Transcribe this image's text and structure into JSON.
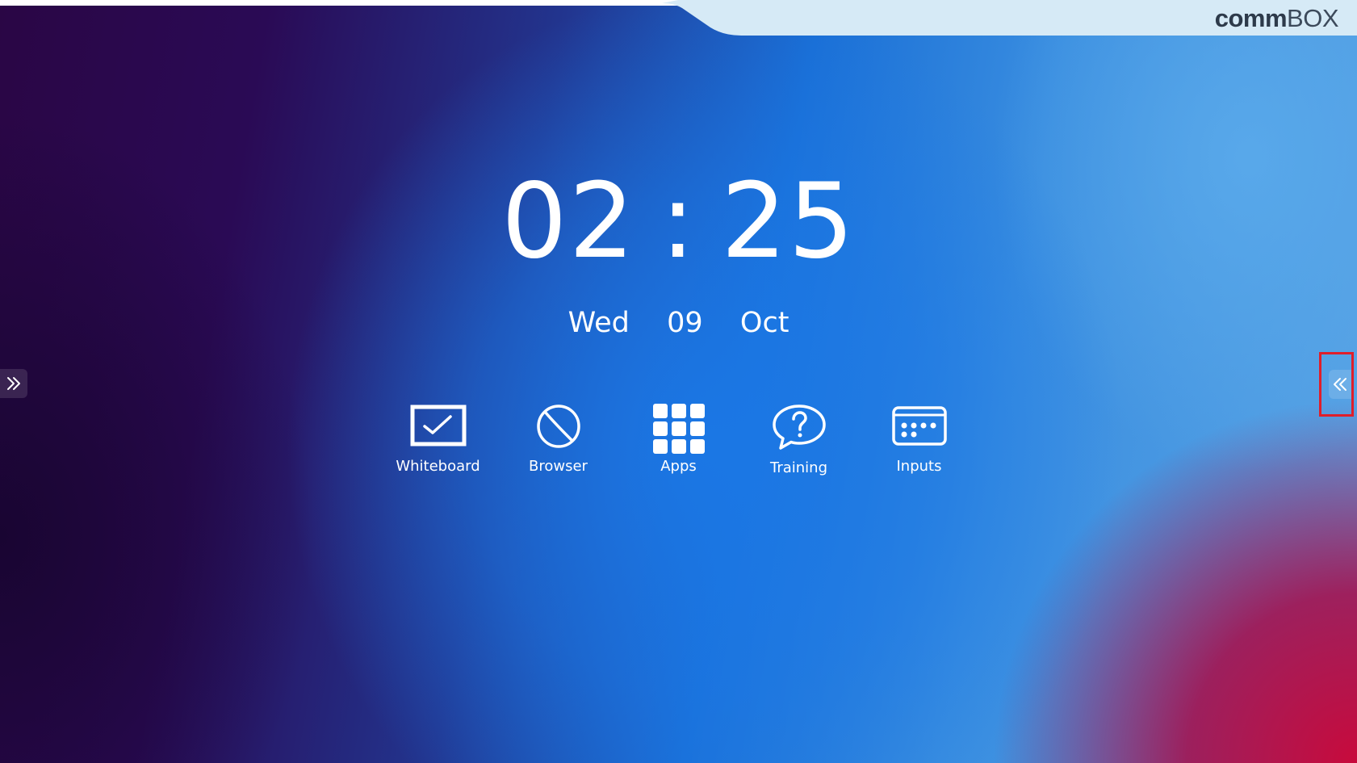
{
  "header": {
    "brand_bold": "comm",
    "brand_light": "BOX"
  },
  "clock": {
    "hours": "02",
    "separator": ":",
    "minutes": "25"
  },
  "date": {
    "text": "Wed  09  Oct"
  },
  "dock": {
    "items": [
      {
        "label": "Whiteboard",
        "icon": "whiteboard-icon"
      },
      {
        "label": "Browser",
        "icon": "globe-icon"
      },
      {
        "label": "Apps",
        "icon": "grid-icon"
      },
      {
        "label": "Training",
        "icon": "help-bubble-icon"
      },
      {
        "label": "Inputs",
        "icon": "inputs-icon"
      }
    ]
  },
  "side_panels": {
    "left_icon": "double-chevron-right-icon",
    "right_icon": "double-chevron-left-icon"
  },
  "colors": {
    "highlight_border": "#e01e2a",
    "text": "#ffffff"
  }
}
